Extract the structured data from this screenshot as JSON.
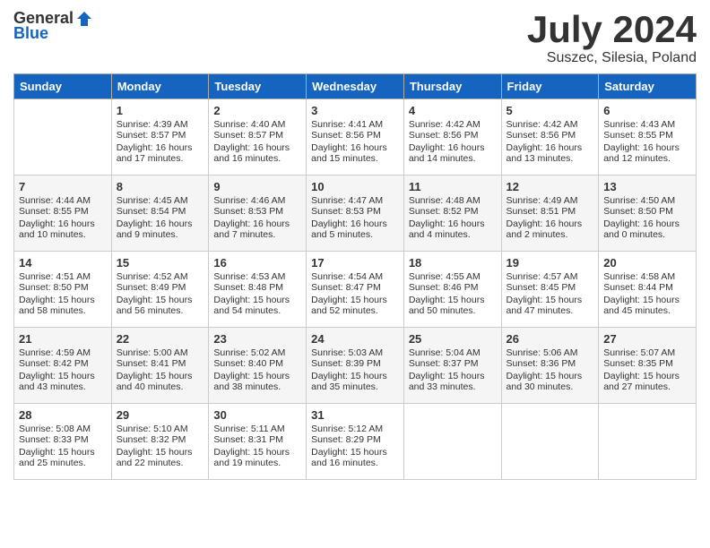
{
  "header": {
    "logo_general": "General",
    "logo_blue": "Blue",
    "month_title": "July 2024",
    "subtitle": "Suszec, Silesia, Poland"
  },
  "weekdays": [
    "Sunday",
    "Monday",
    "Tuesday",
    "Wednesday",
    "Thursday",
    "Friday",
    "Saturday"
  ],
  "weeks": [
    [
      {
        "day": "",
        "empty": true
      },
      {
        "day": "1",
        "sunrise": "Sunrise: 4:39 AM",
        "sunset": "Sunset: 8:57 PM",
        "daylight": "Daylight: 16 hours and 17 minutes."
      },
      {
        "day": "2",
        "sunrise": "Sunrise: 4:40 AM",
        "sunset": "Sunset: 8:57 PM",
        "daylight": "Daylight: 16 hours and 16 minutes."
      },
      {
        "day": "3",
        "sunrise": "Sunrise: 4:41 AM",
        "sunset": "Sunset: 8:56 PM",
        "daylight": "Daylight: 16 hours and 15 minutes."
      },
      {
        "day": "4",
        "sunrise": "Sunrise: 4:42 AM",
        "sunset": "Sunset: 8:56 PM",
        "daylight": "Daylight: 16 hours and 14 minutes."
      },
      {
        "day": "5",
        "sunrise": "Sunrise: 4:42 AM",
        "sunset": "Sunset: 8:56 PM",
        "daylight": "Daylight: 16 hours and 13 minutes."
      },
      {
        "day": "6",
        "sunrise": "Sunrise: 4:43 AM",
        "sunset": "Sunset: 8:55 PM",
        "daylight": "Daylight: 16 hours and 12 minutes."
      }
    ],
    [
      {
        "day": "7",
        "sunrise": "Sunrise: 4:44 AM",
        "sunset": "Sunset: 8:55 PM",
        "daylight": "Daylight: 16 hours and 10 minutes."
      },
      {
        "day": "8",
        "sunrise": "Sunrise: 4:45 AM",
        "sunset": "Sunset: 8:54 PM",
        "daylight": "Daylight: 16 hours and 9 minutes."
      },
      {
        "day": "9",
        "sunrise": "Sunrise: 4:46 AM",
        "sunset": "Sunset: 8:53 PM",
        "daylight": "Daylight: 16 hours and 7 minutes."
      },
      {
        "day": "10",
        "sunrise": "Sunrise: 4:47 AM",
        "sunset": "Sunset: 8:53 PM",
        "daylight": "Daylight: 16 hours and 5 minutes."
      },
      {
        "day": "11",
        "sunrise": "Sunrise: 4:48 AM",
        "sunset": "Sunset: 8:52 PM",
        "daylight": "Daylight: 16 hours and 4 minutes."
      },
      {
        "day": "12",
        "sunrise": "Sunrise: 4:49 AM",
        "sunset": "Sunset: 8:51 PM",
        "daylight": "Daylight: 16 hours and 2 minutes."
      },
      {
        "day": "13",
        "sunrise": "Sunrise: 4:50 AM",
        "sunset": "Sunset: 8:50 PM",
        "daylight": "Daylight: 16 hours and 0 minutes."
      }
    ],
    [
      {
        "day": "14",
        "sunrise": "Sunrise: 4:51 AM",
        "sunset": "Sunset: 8:50 PM",
        "daylight": "Daylight: 15 hours and 58 minutes."
      },
      {
        "day": "15",
        "sunrise": "Sunrise: 4:52 AM",
        "sunset": "Sunset: 8:49 PM",
        "daylight": "Daylight: 15 hours and 56 minutes."
      },
      {
        "day": "16",
        "sunrise": "Sunrise: 4:53 AM",
        "sunset": "Sunset: 8:48 PM",
        "daylight": "Daylight: 15 hours and 54 minutes."
      },
      {
        "day": "17",
        "sunrise": "Sunrise: 4:54 AM",
        "sunset": "Sunset: 8:47 PM",
        "daylight": "Daylight: 15 hours and 52 minutes."
      },
      {
        "day": "18",
        "sunrise": "Sunrise: 4:55 AM",
        "sunset": "Sunset: 8:46 PM",
        "daylight": "Daylight: 15 hours and 50 minutes."
      },
      {
        "day": "19",
        "sunrise": "Sunrise: 4:57 AM",
        "sunset": "Sunset: 8:45 PM",
        "daylight": "Daylight: 15 hours and 47 minutes."
      },
      {
        "day": "20",
        "sunrise": "Sunrise: 4:58 AM",
        "sunset": "Sunset: 8:44 PM",
        "daylight": "Daylight: 15 hours and 45 minutes."
      }
    ],
    [
      {
        "day": "21",
        "sunrise": "Sunrise: 4:59 AM",
        "sunset": "Sunset: 8:42 PM",
        "daylight": "Daylight: 15 hours and 43 minutes."
      },
      {
        "day": "22",
        "sunrise": "Sunrise: 5:00 AM",
        "sunset": "Sunset: 8:41 PM",
        "daylight": "Daylight: 15 hours and 40 minutes."
      },
      {
        "day": "23",
        "sunrise": "Sunrise: 5:02 AM",
        "sunset": "Sunset: 8:40 PM",
        "daylight": "Daylight: 15 hours and 38 minutes."
      },
      {
        "day": "24",
        "sunrise": "Sunrise: 5:03 AM",
        "sunset": "Sunset: 8:39 PM",
        "daylight": "Daylight: 15 hours and 35 minutes."
      },
      {
        "day": "25",
        "sunrise": "Sunrise: 5:04 AM",
        "sunset": "Sunset: 8:37 PM",
        "daylight": "Daylight: 15 hours and 33 minutes."
      },
      {
        "day": "26",
        "sunrise": "Sunrise: 5:06 AM",
        "sunset": "Sunset: 8:36 PM",
        "daylight": "Daylight: 15 hours and 30 minutes."
      },
      {
        "day": "27",
        "sunrise": "Sunrise: 5:07 AM",
        "sunset": "Sunset: 8:35 PM",
        "daylight": "Daylight: 15 hours and 27 minutes."
      }
    ],
    [
      {
        "day": "28",
        "sunrise": "Sunrise: 5:08 AM",
        "sunset": "Sunset: 8:33 PM",
        "daylight": "Daylight: 15 hours and 25 minutes."
      },
      {
        "day": "29",
        "sunrise": "Sunrise: 5:10 AM",
        "sunset": "Sunset: 8:32 PM",
        "daylight": "Daylight: 15 hours and 22 minutes."
      },
      {
        "day": "30",
        "sunrise": "Sunrise: 5:11 AM",
        "sunset": "Sunset: 8:31 PM",
        "daylight": "Daylight: 15 hours and 19 minutes."
      },
      {
        "day": "31",
        "sunrise": "Sunrise: 5:12 AM",
        "sunset": "Sunset: 8:29 PM",
        "daylight": "Daylight: 15 hours and 16 minutes."
      },
      {
        "day": "",
        "empty": true
      },
      {
        "day": "",
        "empty": true
      },
      {
        "day": "",
        "empty": true
      }
    ]
  ]
}
